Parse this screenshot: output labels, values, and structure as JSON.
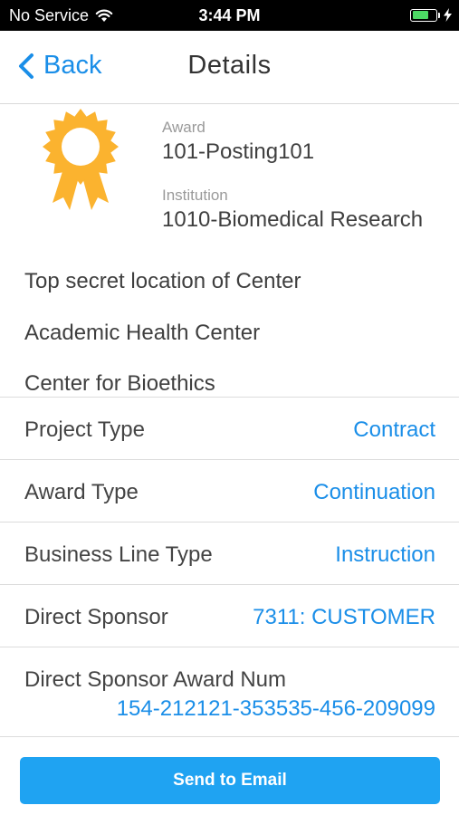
{
  "status_bar": {
    "carrier": "No Service",
    "time": "3:44 PM",
    "battery_level": 0.7,
    "icons": [
      "wifi-icon",
      "battery-icon",
      "charging-bolt-icon"
    ]
  },
  "nav": {
    "back_label": "Back",
    "title": "Details",
    "accent_color": "#1a8ee8"
  },
  "award_header": {
    "icon": "award-ribbon-icon",
    "icon_color": "#fbb32f",
    "award_label": "Award",
    "award_value": "101-Posting101",
    "institution_label": "Institution",
    "institution_value": "1010-Biomedical Research"
  },
  "location_lines": [
    "Top secret location of Center",
    "Academic Health Center",
    "Center for Bioethics"
  ],
  "details": [
    {
      "label": "Project Type",
      "value": "Contract"
    },
    {
      "label": "Award Type",
      "value": "Continuation"
    },
    {
      "label": "Business Line Type",
      "value": "Instruction"
    },
    {
      "label": "Direct Sponsor",
      "value": "7311: CUSTOMER"
    },
    {
      "label": "Direct Sponsor Award Num",
      "value": "154-212121-353535-456-209099"
    }
  ],
  "actions": {
    "send_email_label": "Send to Email",
    "button_color": "#1fa3f2"
  }
}
